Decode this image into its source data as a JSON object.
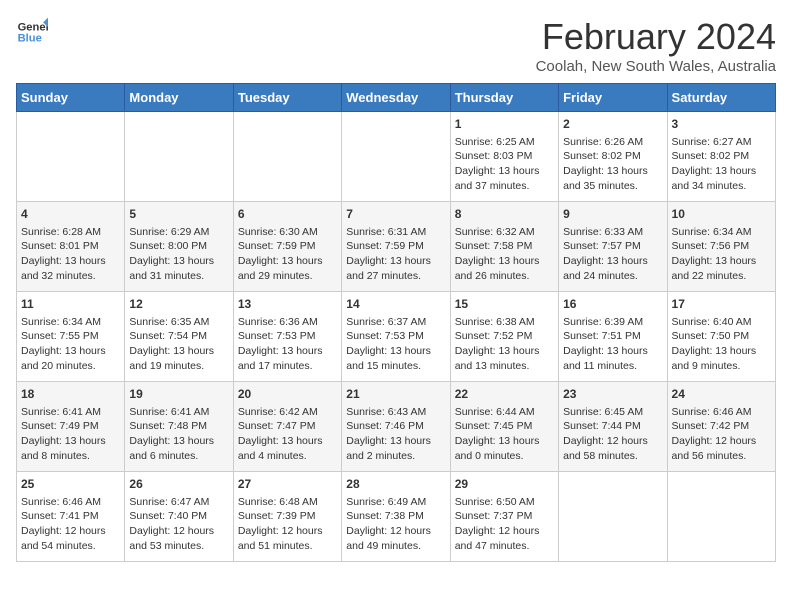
{
  "header": {
    "logo_line1": "General",
    "logo_line2": "Blue",
    "title": "February 2024",
    "subtitle": "Coolah, New South Wales, Australia"
  },
  "days_of_week": [
    "Sunday",
    "Monday",
    "Tuesday",
    "Wednesday",
    "Thursday",
    "Friday",
    "Saturday"
  ],
  "weeks": [
    [
      {
        "day": "",
        "info": ""
      },
      {
        "day": "",
        "info": ""
      },
      {
        "day": "",
        "info": ""
      },
      {
        "day": "",
        "info": ""
      },
      {
        "day": "1",
        "info": "Sunrise: 6:25 AM\nSunset: 8:03 PM\nDaylight: 13 hours\nand 37 minutes."
      },
      {
        "day": "2",
        "info": "Sunrise: 6:26 AM\nSunset: 8:02 PM\nDaylight: 13 hours\nand 35 minutes."
      },
      {
        "day": "3",
        "info": "Sunrise: 6:27 AM\nSunset: 8:02 PM\nDaylight: 13 hours\nand 34 minutes."
      }
    ],
    [
      {
        "day": "4",
        "info": "Sunrise: 6:28 AM\nSunset: 8:01 PM\nDaylight: 13 hours\nand 32 minutes."
      },
      {
        "day": "5",
        "info": "Sunrise: 6:29 AM\nSunset: 8:00 PM\nDaylight: 13 hours\nand 31 minutes."
      },
      {
        "day": "6",
        "info": "Sunrise: 6:30 AM\nSunset: 7:59 PM\nDaylight: 13 hours\nand 29 minutes."
      },
      {
        "day": "7",
        "info": "Sunrise: 6:31 AM\nSunset: 7:59 PM\nDaylight: 13 hours\nand 27 minutes."
      },
      {
        "day": "8",
        "info": "Sunrise: 6:32 AM\nSunset: 7:58 PM\nDaylight: 13 hours\nand 26 minutes."
      },
      {
        "day": "9",
        "info": "Sunrise: 6:33 AM\nSunset: 7:57 PM\nDaylight: 13 hours\nand 24 minutes."
      },
      {
        "day": "10",
        "info": "Sunrise: 6:34 AM\nSunset: 7:56 PM\nDaylight: 13 hours\nand 22 minutes."
      }
    ],
    [
      {
        "day": "11",
        "info": "Sunrise: 6:34 AM\nSunset: 7:55 PM\nDaylight: 13 hours\nand 20 minutes."
      },
      {
        "day": "12",
        "info": "Sunrise: 6:35 AM\nSunset: 7:54 PM\nDaylight: 13 hours\nand 19 minutes."
      },
      {
        "day": "13",
        "info": "Sunrise: 6:36 AM\nSunset: 7:53 PM\nDaylight: 13 hours\nand 17 minutes."
      },
      {
        "day": "14",
        "info": "Sunrise: 6:37 AM\nSunset: 7:53 PM\nDaylight: 13 hours\nand 15 minutes."
      },
      {
        "day": "15",
        "info": "Sunrise: 6:38 AM\nSunset: 7:52 PM\nDaylight: 13 hours\nand 13 minutes."
      },
      {
        "day": "16",
        "info": "Sunrise: 6:39 AM\nSunset: 7:51 PM\nDaylight: 13 hours\nand 11 minutes."
      },
      {
        "day": "17",
        "info": "Sunrise: 6:40 AM\nSunset: 7:50 PM\nDaylight: 13 hours\nand 9 minutes."
      }
    ],
    [
      {
        "day": "18",
        "info": "Sunrise: 6:41 AM\nSunset: 7:49 PM\nDaylight: 13 hours\nand 8 minutes."
      },
      {
        "day": "19",
        "info": "Sunrise: 6:41 AM\nSunset: 7:48 PM\nDaylight: 13 hours\nand 6 minutes."
      },
      {
        "day": "20",
        "info": "Sunrise: 6:42 AM\nSunset: 7:47 PM\nDaylight: 13 hours\nand 4 minutes."
      },
      {
        "day": "21",
        "info": "Sunrise: 6:43 AM\nSunset: 7:46 PM\nDaylight: 13 hours\nand 2 minutes."
      },
      {
        "day": "22",
        "info": "Sunrise: 6:44 AM\nSunset: 7:45 PM\nDaylight: 13 hours\nand 0 minutes."
      },
      {
        "day": "23",
        "info": "Sunrise: 6:45 AM\nSunset: 7:44 PM\nDaylight: 12 hours\nand 58 minutes."
      },
      {
        "day": "24",
        "info": "Sunrise: 6:46 AM\nSunset: 7:42 PM\nDaylight: 12 hours\nand 56 minutes."
      }
    ],
    [
      {
        "day": "25",
        "info": "Sunrise: 6:46 AM\nSunset: 7:41 PM\nDaylight: 12 hours\nand 54 minutes."
      },
      {
        "day": "26",
        "info": "Sunrise: 6:47 AM\nSunset: 7:40 PM\nDaylight: 12 hours\nand 53 minutes."
      },
      {
        "day": "27",
        "info": "Sunrise: 6:48 AM\nSunset: 7:39 PM\nDaylight: 12 hours\nand 51 minutes."
      },
      {
        "day": "28",
        "info": "Sunrise: 6:49 AM\nSunset: 7:38 PM\nDaylight: 12 hours\nand 49 minutes."
      },
      {
        "day": "29",
        "info": "Sunrise: 6:50 AM\nSunset: 7:37 PM\nDaylight: 12 hours\nand 47 minutes."
      },
      {
        "day": "",
        "info": ""
      },
      {
        "day": "",
        "info": ""
      }
    ]
  ]
}
